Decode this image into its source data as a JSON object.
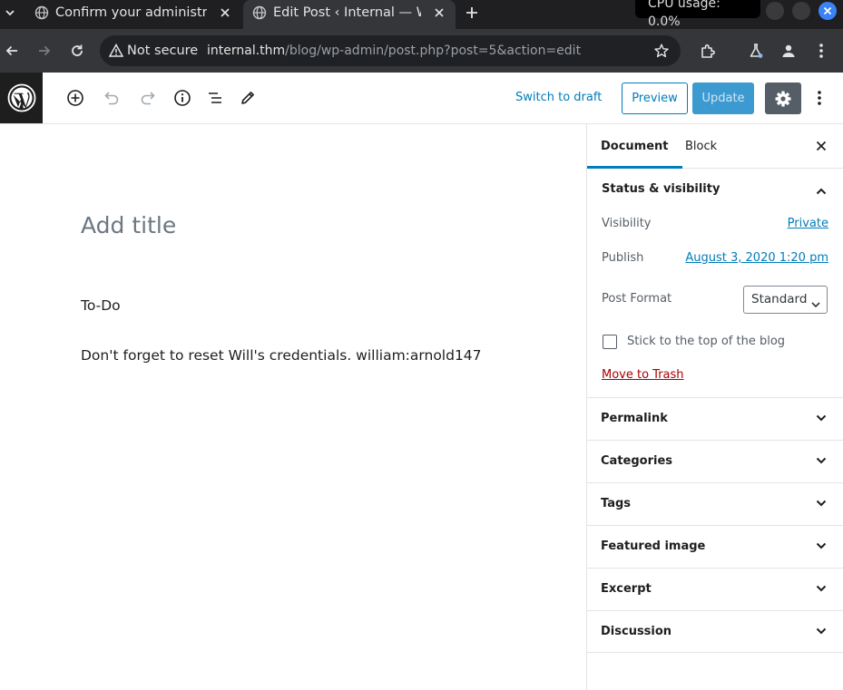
{
  "browser": {
    "tabs": [
      {
        "title": "Confirm your administra"
      },
      {
        "title": "Edit Post ‹ Internal — Wo"
      }
    ],
    "cpu_usage": "CPU usage: 0.0%",
    "security_label": "Not secure",
    "url_host": "internal.thm",
    "url_path": "/blog/wp-admin/post.php?post=5&action=edit"
  },
  "header": {
    "switch_to_draft": "Switch to draft",
    "preview": "Preview",
    "update": "Update"
  },
  "editor": {
    "title_placeholder": "Add title",
    "paragraphs": [
      "To-Do",
      "Don't forget to reset Will's credentials. william:arnold147"
    ]
  },
  "sidebar": {
    "tabs": [
      "Document",
      "Block"
    ],
    "status_panel": {
      "title": "Status & visibility",
      "visibility_label": "Visibility",
      "visibility_value": "Private",
      "publish_label": "Publish",
      "publish_value": "August 3, 2020 1:20 pm",
      "post_format_label": "Post Format",
      "post_format_value": "Standard",
      "sticky_label": "Stick to the top of the blog",
      "trash_label": "Move to Trash"
    },
    "panels": [
      "Permalink",
      "Categories",
      "Tags",
      "Featured image",
      "Excerpt",
      "Discussion"
    ]
  },
  "colors": {
    "accent": "#007cba",
    "update_button": "#3d9ad1",
    "trash": "#aa0000"
  }
}
